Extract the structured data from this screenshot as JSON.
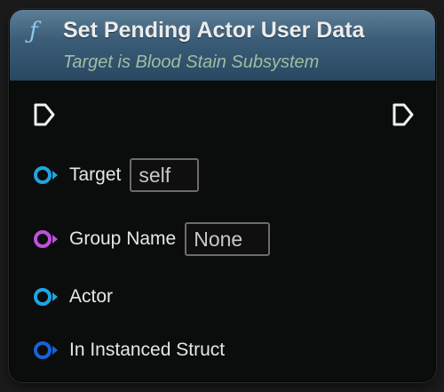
{
  "node": {
    "title": "Set Pending Actor User Data",
    "subtitle": "Target is Blood Stain Subsystem",
    "function_icon": "ƒ"
  },
  "pins": {
    "exec_in": {
      "icon": "exec-in-icon"
    },
    "exec_out": {
      "icon": "exec-out-icon"
    },
    "target": {
      "label": "Target",
      "value": "self",
      "color": "#1fa4e3"
    },
    "group_name": {
      "label": "Group Name",
      "value": "None",
      "color": "#c050e0"
    },
    "actor": {
      "label": "Actor",
      "color": "#1fa4e3"
    },
    "in_instanced_struct": {
      "label": "In Instanced Struct",
      "color": "#1862d8"
    }
  }
}
